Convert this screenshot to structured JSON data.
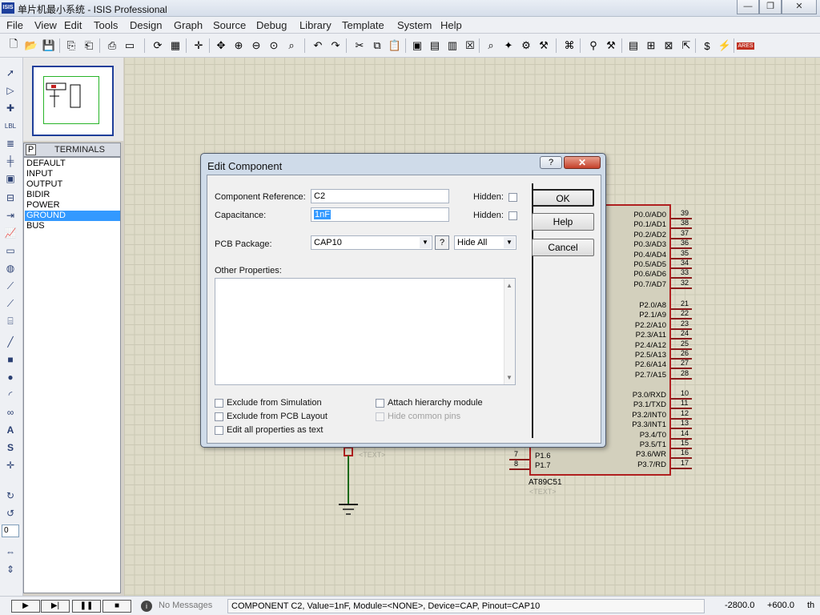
{
  "window": {
    "title": "单片机最小系统 - ISIS Professional",
    "logo": "ISIS"
  },
  "menu": [
    "File",
    "View",
    "Edit",
    "Tools",
    "Design",
    "Graph",
    "Source",
    "Debug",
    "Library",
    "Template",
    "System",
    "Help"
  ],
  "terminals": {
    "tab_letter": "P",
    "title": "TERMINALS",
    "items": [
      "DEFAULT",
      "INPUT",
      "OUTPUT",
      "BIDIR",
      "POWER",
      "GROUND",
      "BUS"
    ],
    "selected": "GROUND"
  },
  "schematic": {
    "chip_name": "AT89C51",
    "chip_text": "<TEXT>",
    "cap_text": "<TEXT>",
    "pins_right": [
      {
        "name": "P0.0/AD0",
        "num": "39"
      },
      {
        "name": "P0.1/AD1",
        "num": "38"
      },
      {
        "name": "P0.2/AD2",
        "num": "37"
      },
      {
        "name": "P0.3/AD3",
        "num": "36"
      },
      {
        "name": "P0.4/AD4",
        "num": "35"
      },
      {
        "name": "P0.5/AD5",
        "num": "34"
      },
      {
        "name": "P0.6/AD6",
        "num": "33"
      },
      {
        "name": "P0.7/AD7",
        "num": "32"
      },
      {
        "name": "P2.0/A8",
        "num": "21"
      },
      {
        "name": "P2.1/A9",
        "num": "22"
      },
      {
        "name": "P2.2/A10",
        "num": "23"
      },
      {
        "name": "P2.3/A11",
        "num": "24"
      },
      {
        "name": "P2.4/A12",
        "num": "25"
      },
      {
        "name": "P2.5/A13",
        "num": "26"
      },
      {
        "name": "P2.6/A14",
        "num": "27"
      },
      {
        "name": "P2.7/A15",
        "num": "28"
      },
      {
        "name": "P3.0/RXD",
        "num": "10"
      },
      {
        "name": "P3.1/TXD",
        "num": "11"
      },
      {
        "name": "P3.2/INT0",
        "num": "12"
      },
      {
        "name": "P3.3/INT1",
        "num": "13"
      },
      {
        "name": "P3.4/T0",
        "num": "14"
      },
      {
        "name": "P3.5/T1",
        "num": "15"
      },
      {
        "name": "P3.6/WR",
        "num": "16"
      },
      {
        "name": "P3.7/RD",
        "num": "17"
      }
    ],
    "pins_left": [
      {
        "name": "P1.6",
        "num": "7"
      },
      {
        "name": "P1.7",
        "num": "8"
      }
    ]
  },
  "dialog": {
    "title": "Edit Component",
    "help_icon": "?",
    "close_icon": "✕",
    "component_reference_label": "Component Reference:",
    "component_reference_value": "C2",
    "capacitance_label": "Capacitance:",
    "capacitance_value": "1nF",
    "hidden_label": "Hidden:",
    "pcb_package_label": "PCB Package:",
    "pcb_package_value": "CAP10",
    "hide_all_value": "Hide All",
    "other_properties_label": "Other Properties:",
    "exclude_simulation": "Exclude from Simulation",
    "exclude_pcb": "Exclude from PCB Layout",
    "edit_all_props": "Edit all properties as text",
    "attach_hierarchy": "Attach hierarchy module",
    "hide_common_pins": "Hide common pins",
    "ok_label": "OK",
    "help_label": "Help",
    "cancel_label": "Cancel"
  },
  "statusbar": {
    "messages": "No Messages",
    "info": "COMPONENT C2, Value=1nF, Module=<NONE>, Device=CAP, Pinout=CAP10",
    "coord_x": "-2800.0",
    "coord_y": "+600.0",
    "unit": "th"
  },
  "zoom_field_value": "0",
  "colors": {
    "canvas": "#dedbc8",
    "chip_border": "#b02020",
    "selection": "#3399ff",
    "dialog_frame": "#cfdbe9"
  }
}
